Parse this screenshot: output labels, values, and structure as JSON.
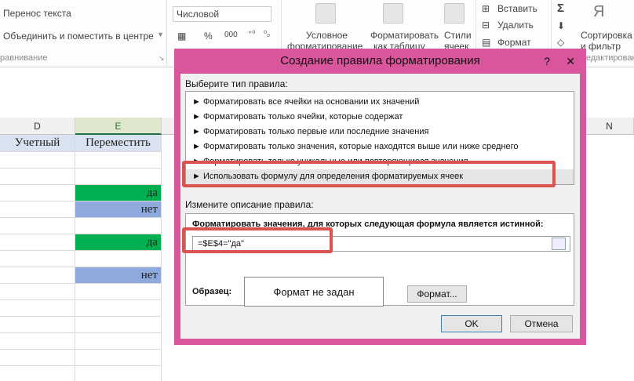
{
  "ribbon": {
    "wrap_text": "Перенос текста",
    "merge_center": "Объединить и поместить в центре",
    "alignment_group": "равнивание",
    "number_format": "Числовой",
    "percent": "%",
    "thousands": "000",
    "cond_format": "Условное",
    "cond_format2": "форматирование",
    "format_table": "Форматировать",
    "format_table2": "как таблицу",
    "cell_styles": "Стили",
    "cell_styles2": "ячеек",
    "insert": "Вставить",
    "delete": "Удалить",
    "format": "Формат",
    "sigma": "Σ",
    "sort_filter": "Сортировка",
    "sort_filter2": "и фильтр",
    "editing_group": "Редактирован"
  },
  "sheet": {
    "col_d": "D",
    "col_e": "E",
    "col_n": "N",
    "hdr_d": "Учетный",
    "hdr_e": "Переместить",
    "rows": [
      {
        "value": "",
        "fill": ""
      },
      {
        "value": "",
        "fill": ""
      },
      {
        "value": "да",
        "fill": "#00b050"
      },
      {
        "value": "нет",
        "fill": "#8ea9db"
      },
      {
        "value": "",
        "fill": ""
      },
      {
        "value": "да",
        "fill": "#00b050"
      },
      {
        "value": "",
        "fill": ""
      },
      {
        "value": "нет",
        "fill": "#8ea9db"
      },
      {
        "value": "",
        "fill": ""
      },
      {
        "value": "",
        "fill": ""
      },
      {
        "value": "",
        "fill": ""
      },
      {
        "value": "",
        "fill": ""
      },
      {
        "value": "",
        "fill": ""
      },
      {
        "value": "",
        "fill": ""
      },
      {
        "value": "",
        "fill": ""
      }
    ]
  },
  "dialog": {
    "title": "Создание правила форматирования",
    "help": "?",
    "close": "✕",
    "select_type_label": "Выберите тип правила:",
    "rule_types": [
      "► Форматировать все ячейки на основании их значений",
      "► Форматировать только ячейки, которые содержат",
      "► Форматировать только первые или последние значения",
      "► Форматировать только значения, которые находятся выше или ниже среднего",
      "► Форматировать только уникальные или повторяющиеся значения",
      "► Использовать формулу для определения форматируемых ячеек"
    ],
    "selected_index": 5,
    "edit_desc_label": "Измените описание правила:",
    "formula_label": "Форматировать значения, для которых следующая формула является истинной:",
    "formula_value": "=$E$4=\"да\"",
    "sample_label": "Образец:",
    "sample_text": "Формат не задан",
    "format_button": "Формат...",
    "ok_button": "OK",
    "cancel_button": "Отмена"
  },
  "colors": {
    "dialog_border": "#d9559c",
    "highlight": "#d9534f",
    "green_fill": "#00b050",
    "blue_fill": "#8ea9db",
    "header_fill": "#d9e2f0"
  }
}
